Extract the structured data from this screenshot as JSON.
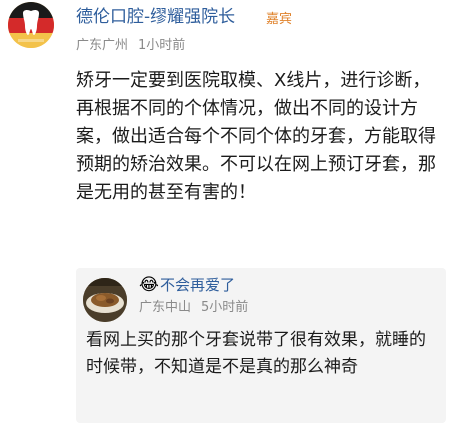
{
  "comment": {
    "author_name": "德伦口腔-缪耀强院长",
    "badge": "嘉宾",
    "location": "广东广州",
    "time": "1小时前",
    "text": "矫牙一定要到医院取模、X线片，进行诊断，再根据不同的个体情况，做出不同的设计方案，做出适合每个不同个体的牙套，方能取得预期的矫治效果。不可以在网上预订牙套，那是无用的甚至有害的！"
  },
  "reply": {
    "emoji": "😂",
    "author_name": "不会再爱了",
    "location": "广东中山",
    "time": "5小时前",
    "text": "看网上买的那个牙套说带了很有效果，就睡的时候带，不知道是不是真的那么神奇"
  },
  "colors": {
    "name_link": "#2f5e9c",
    "badge": "#e0842e",
    "meta": "#8a8a8a",
    "reply_bg": "#f4f4f4"
  }
}
